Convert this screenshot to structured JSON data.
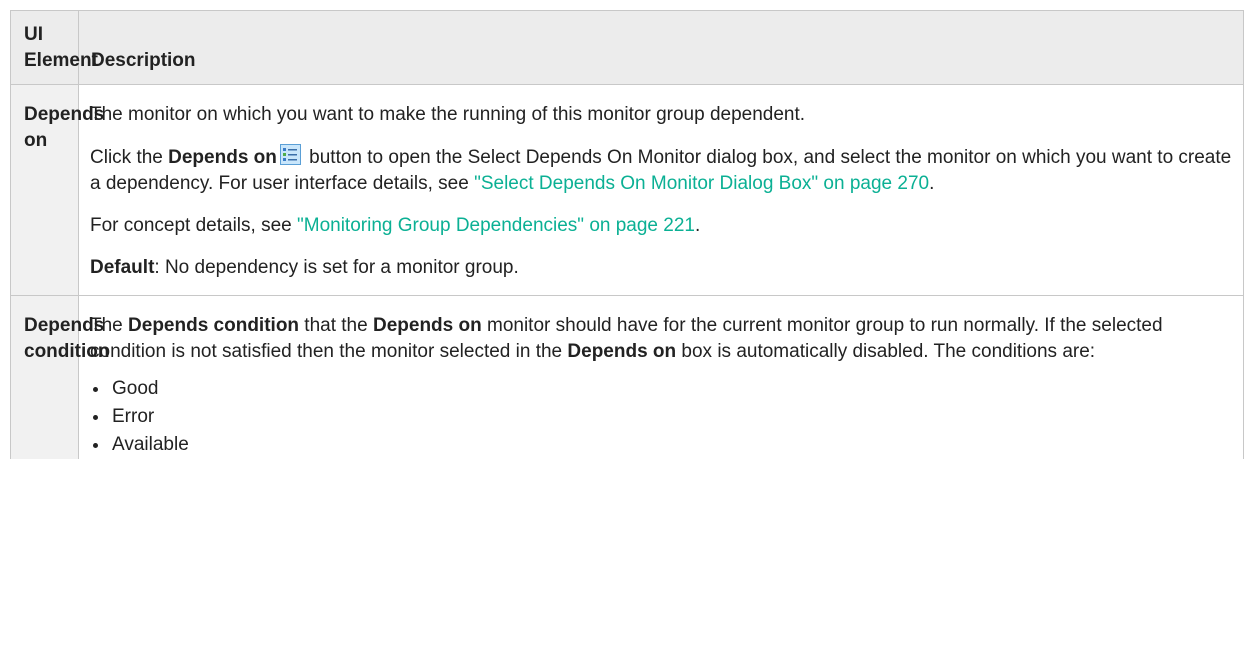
{
  "table": {
    "headers": {
      "element": "UI Element",
      "description": "Description"
    },
    "rows": [
      {
        "element": "Depends on",
        "p1": "The monitor on which you want to make the running of this monitor group dependent.",
        "p2": {
          "prefix": "Click the ",
          "bold": "Depends on",
          "middle": " button to open the Select Depends On Monitor dialog box, and select the monitor on which you want to create a dependency. For user interface details, see ",
          "link": "\"Select Depends On Monitor Dialog Box\" on page 270",
          "suffix": "."
        },
        "p3": {
          "prefix": "For concept details, see ",
          "link": "\"Monitoring Group Dependencies\" on page 221",
          "suffix": "."
        },
        "p4": {
          "bold": "Default",
          "text": ": No dependency is set for a monitor group."
        },
        "icon": "depends-on-icon"
      },
      {
        "element": "Depends condition",
        "p1": {
          "t1": "The ",
          "b1": "Depends condition",
          "t2": " that the ",
          "b2": "Depends on",
          "t3": " monitor should have for the current monitor group to run normally. If the selected condition is not satisfied then the monitor selected in the ",
          "b3": "Depends on",
          "t4": " box is automatically disabled. The conditions are:"
        },
        "conditions": [
          "Good",
          "Error",
          "Available"
        ]
      }
    ]
  },
  "colors": {
    "link": "#0bb094",
    "header_bg": "#ececec",
    "element_bg": "#f1f1f1",
    "border": "#c8c8c8"
  }
}
